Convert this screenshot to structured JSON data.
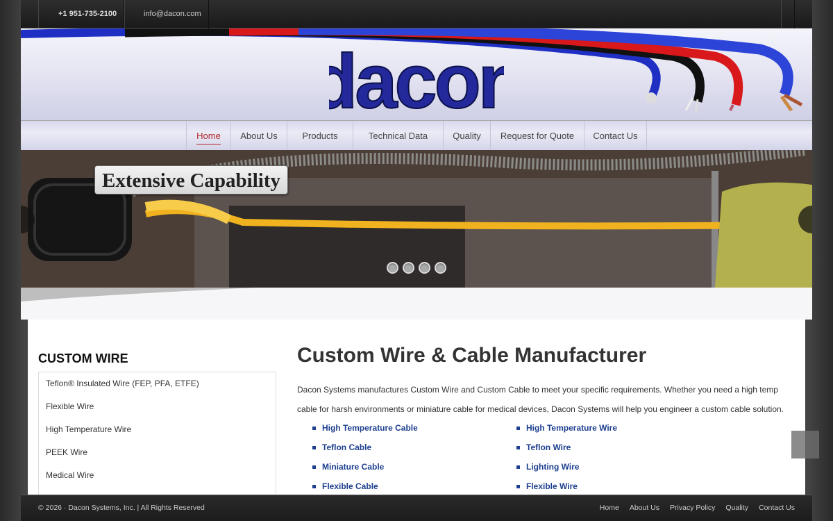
{
  "topbar": {
    "phone": "+1 951-735-2100",
    "email": "info@dacon.com"
  },
  "header": {
    "logo_text": "dacon"
  },
  "nav": {
    "items": [
      {
        "label": "Home",
        "active": true
      },
      {
        "label": "About Us"
      },
      {
        "label": "Products"
      },
      {
        "label": "Technical Data"
      },
      {
        "label": "Quality"
      },
      {
        "label": "Request for Quote"
      },
      {
        "label": "Contact Us"
      }
    ]
  },
  "slider": {
    "caption": "Extensive Capability",
    "slide_count": 4
  },
  "sidebar": {
    "title": "CUSTOM WIRE",
    "items": [
      "Teflon® Insulated Wire (FEP, PFA, ETFE)",
      "Flexible Wire",
      "High Temperature Wire",
      "PEEK Wire",
      "Medical Wire"
    ]
  },
  "main": {
    "title": "Custom Wire & Cable Manufacturer",
    "intro": "Dacon Systems manufactures Custom Wire and Custom Cable to meet your specific requirements. Whether you need a high temp cable for harsh environments or miniature cable for medical devices, Dacon Systems will help you engineer a custom cable solution.",
    "links_left": [
      "High Temperature Cable",
      "Teflon Cable",
      "Miniature Cable",
      "Flexible Cable"
    ],
    "links_right": [
      "High Temperature Wire",
      "Teflon Wire",
      "Lighting Wire",
      "Flexible Wire"
    ]
  },
  "footer": {
    "copyright": "© 2026 · Dacon Systems, Inc. | All Rights Reserved",
    "links": [
      "Home",
      "About Us",
      "Privacy Policy",
      "Quality",
      "Contact Us"
    ]
  },
  "colors": {
    "link_blue": "#1d3f8f",
    "active_red": "#b12727",
    "cable_blue": "#1f2fc4",
    "cable_red": "#d8181b"
  }
}
